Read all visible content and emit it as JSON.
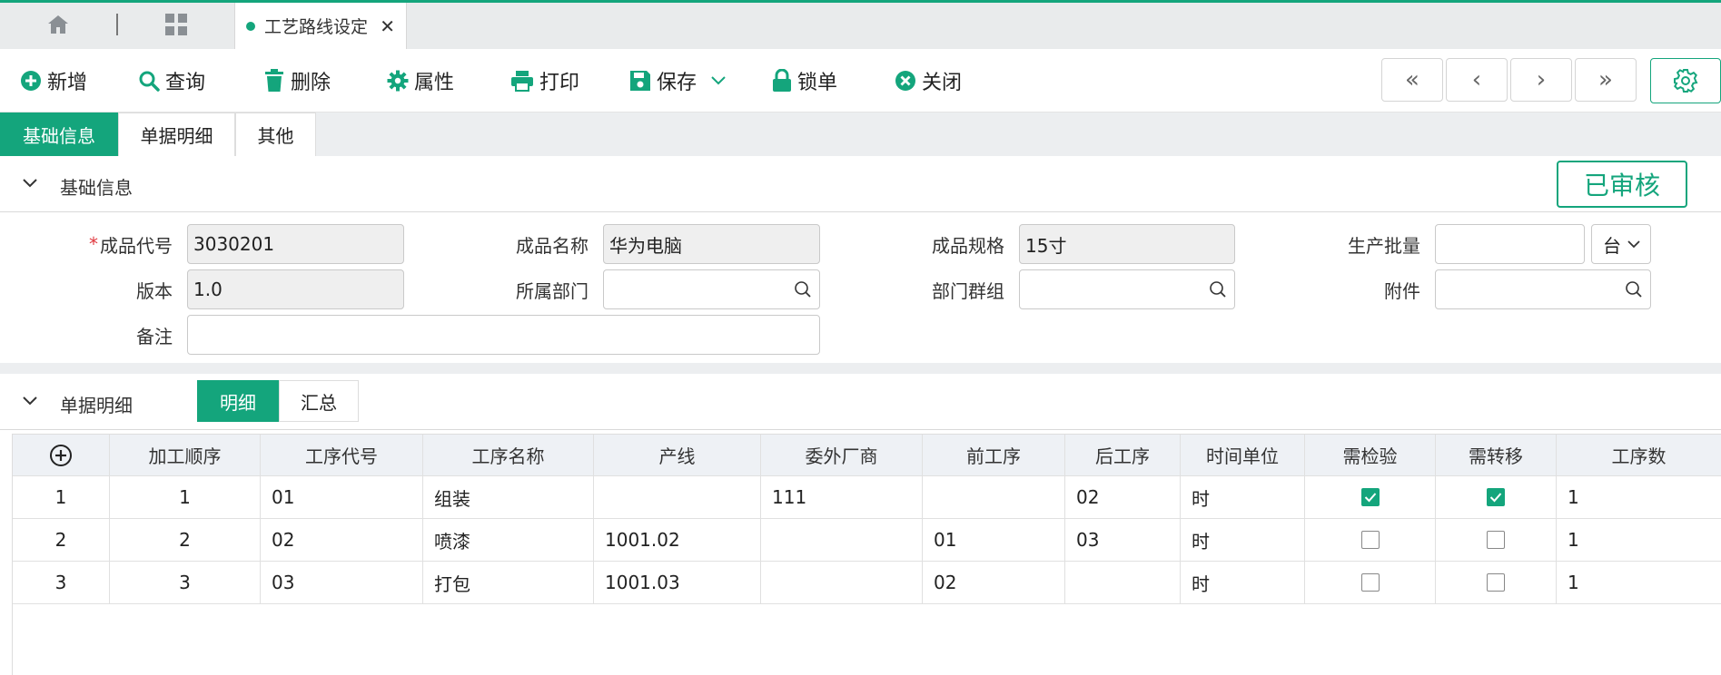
{
  "tabs": {
    "active_doc": "工艺路线设定"
  },
  "toolbar": {
    "add": "新增",
    "query": "查询",
    "delete": "删除",
    "props": "属性",
    "print": "打印",
    "save": "保存",
    "lock": "锁单",
    "close": "关闭",
    "nav_first": "«",
    "nav_prev": "‹",
    "nav_next": "›",
    "nav_last": "»"
  },
  "section_tabs": [
    "基础信息",
    "单据明细",
    "其他"
  ],
  "base_section": {
    "title": "基础信息",
    "status": "已审核"
  },
  "form": {
    "product_code_label": "成品代号",
    "product_code": "3030201",
    "product_name_label": "成品名称",
    "product_name": "华为电脑",
    "product_spec_label": "成品规格",
    "product_spec": "15寸",
    "batch_label": "生产批量",
    "batch": "",
    "batch_unit": "台",
    "version_label": "版本",
    "version": "1.0",
    "dept_label": "所属部门",
    "dept": "",
    "dept_group_label": "部门群组",
    "dept_group": "",
    "attachment_label": "附件",
    "attachment": "",
    "remark_label": "备注",
    "remark": ""
  },
  "detail_section": {
    "title": "单据明细",
    "subtabs": [
      "明细",
      "汇总"
    ]
  },
  "grid": {
    "add_icon": "plus-circle-icon",
    "columns": [
      "加工顺序",
      "工序代号",
      "工序名称",
      "产线",
      "委外厂商",
      "前工序",
      "后工序",
      "时间单位",
      "需检验",
      "需转移",
      "工序数"
    ],
    "rows": [
      {
        "idx": "1",
        "seq": "1",
        "code": "01",
        "name": "组装",
        "line": "",
        "vendor": "111",
        "prev": "",
        "next": "02",
        "unit": "时",
        "inspect": true,
        "transfer": true,
        "count": "1"
      },
      {
        "idx": "2",
        "seq": "2",
        "code": "02",
        "name": "喷漆",
        "line": "1001.02",
        "vendor": "",
        "prev": "01",
        "next": "03",
        "unit": "时",
        "inspect": false,
        "transfer": false,
        "count": "1"
      },
      {
        "idx": "3",
        "seq": "3",
        "code": "03",
        "name": "打包",
        "line": "1001.03",
        "vendor": "",
        "prev": "02",
        "next": "",
        "unit": "时",
        "inspect": false,
        "transfer": false,
        "count": "1"
      }
    ]
  },
  "colors": {
    "accent": "#14a57c",
    "required": "#e0383e"
  }
}
